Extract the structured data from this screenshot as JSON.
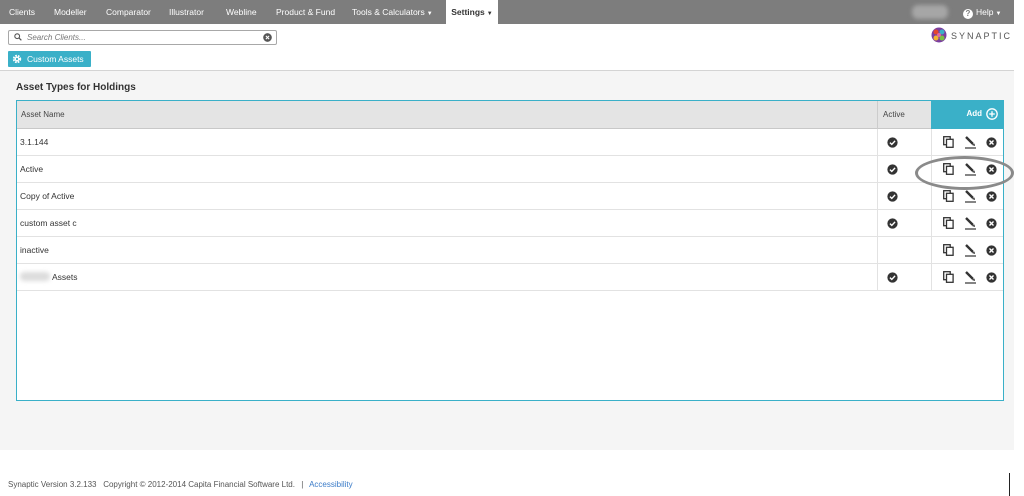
{
  "nav": {
    "items": [
      {
        "label": "Clients"
      },
      {
        "label": "Modeller"
      },
      {
        "label": "Comparator"
      },
      {
        "label": "Illustrator"
      },
      {
        "label": "Webline"
      },
      {
        "label": "Product & Fund"
      },
      {
        "label": "Tools & Calculators",
        "dropdown": true
      },
      {
        "label": "Settings",
        "dropdown": true,
        "active": true
      }
    ],
    "help_label": "Help",
    "caret": "▼"
  },
  "search": {
    "placeholder": "Search Clients..."
  },
  "logo": {
    "text": "SYNAPTIC"
  },
  "custom_assets_button": {
    "label": "Custom Assets"
  },
  "page": {
    "title": "Asset Types for Holdings"
  },
  "table": {
    "columns": {
      "name": "Asset Name",
      "active": "Active",
      "add": "Add"
    },
    "rows": [
      {
        "name": "3.1.144",
        "active": true
      },
      {
        "name": "Active",
        "active": true
      },
      {
        "name": "Copy of Active",
        "active": true
      },
      {
        "name": "custom asset c",
        "active": true
      },
      {
        "name": "inactive",
        "active": false
      },
      {
        "name": "Assets",
        "active": true
      }
    ]
  },
  "footer": {
    "version": "Synaptic Version 3.2.133",
    "copyright": "Copyright © 2012-2014 Capita Financial Software Ltd.",
    "separator": "|",
    "accessibility": "Accessibility"
  },
  "colors": {
    "accent": "#3ab0c8",
    "nav_bg": "#7d7d7d",
    "highlight": "#8a8a8a"
  }
}
